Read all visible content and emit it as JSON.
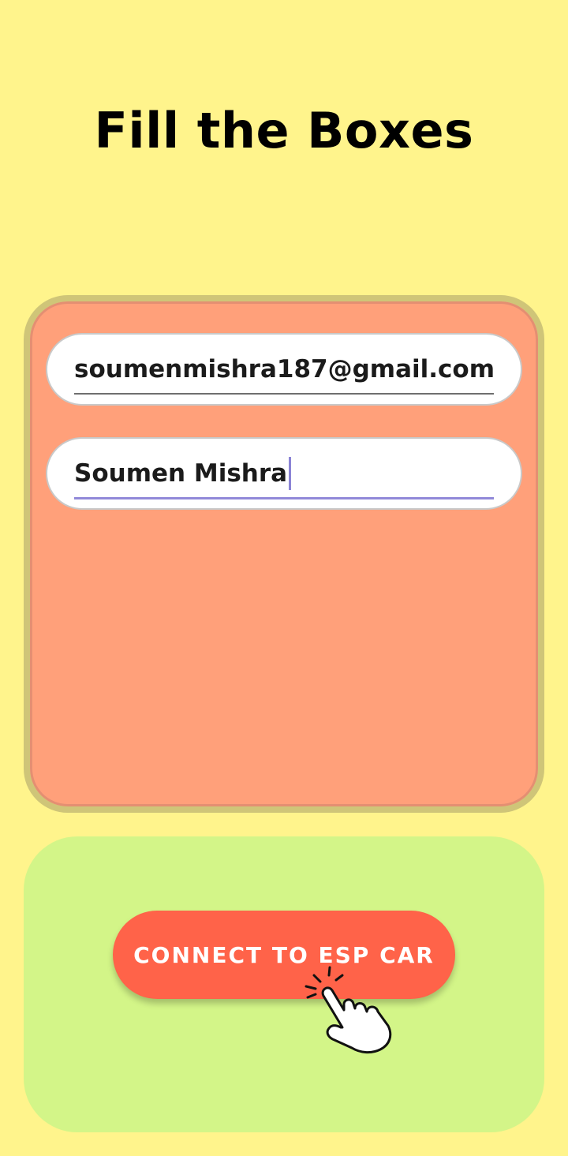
{
  "page": {
    "title": "Fill the Boxes"
  },
  "form": {
    "email_value": "soumenmishra187@gmail.com",
    "name_value": "Soumen Mishra"
  },
  "action": {
    "connect_label": "CONNECT TO ESP CAR",
    "pointer_icon": "tap-hand-icon"
  },
  "colors": {
    "background": "#fff48c",
    "card": "#ffa07a",
    "panel": "#d3f588",
    "button": "#ff6349",
    "focus_underline": "#9189d9"
  }
}
